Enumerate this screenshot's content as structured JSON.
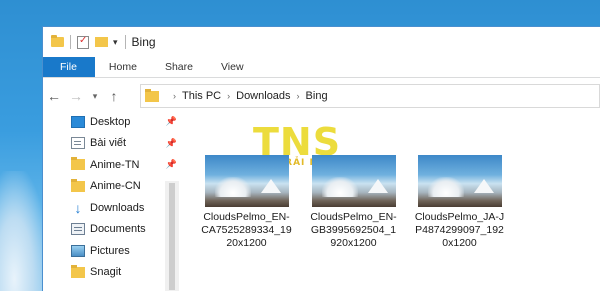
{
  "window": {
    "title": "Bing"
  },
  "ribbon": {
    "tabs": [
      "File",
      "Home",
      "Share",
      "View"
    ]
  },
  "address": {
    "segments": [
      "This PC",
      "Downloads",
      "Bing"
    ]
  },
  "nav_pane": {
    "items": [
      {
        "label": "Desktop",
        "icon": "desktop-icon",
        "pinned": true
      },
      {
        "label": "Bài viết",
        "icon": "document-icon",
        "pinned": true
      },
      {
        "label": "Anime-TN",
        "icon": "folder-icon",
        "pinned": true
      },
      {
        "label": "Anime-CN",
        "icon": "folder-icon",
        "pinned": true
      },
      {
        "label": "Downloads",
        "icon": "download-icon",
        "pinned": true
      },
      {
        "label": "Documents",
        "icon": "documents-icon",
        "pinned": true
      },
      {
        "label": "Pictures",
        "icon": "pictures-icon",
        "pinned": true
      },
      {
        "label": "Snagit",
        "icon": "folder-icon",
        "pinned": true
      }
    ]
  },
  "watermark": {
    "letters": "TNS",
    "subtitle": "TRẢI NGHIỆM SỐ"
  },
  "files": [
    {
      "name": "CloudsPelmo_EN-CA7525289334_1920x1200"
    },
    {
      "name": "CloudsPelmo_EN-GB3995692504_1920x1200"
    },
    {
      "name": "CloudsPelmo_JA-JP4874299097_1920x1200"
    }
  ],
  "colors": {
    "accent": "#1979ca",
    "folder": "#f3c64a",
    "watermark": "#ead828"
  }
}
